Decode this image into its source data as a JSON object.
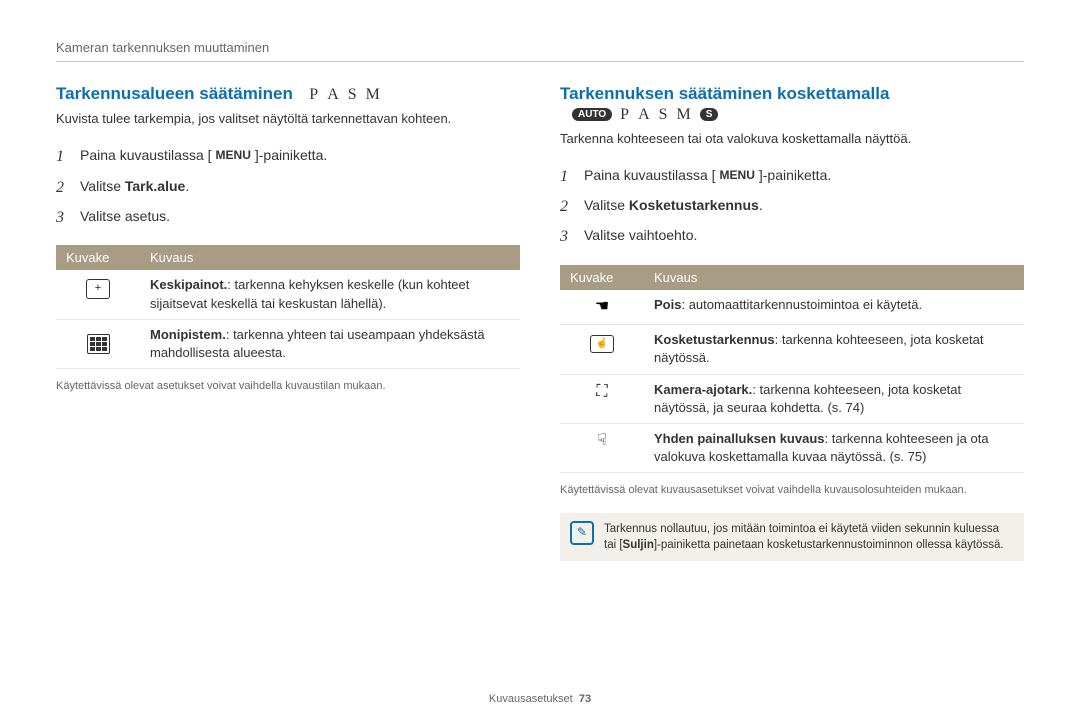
{
  "breadcrumb": "Kameran tarkennuksen muuttaminen",
  "left": {
    "title": "Tarkennusalueen säätäminen",
    "modes": [
      "P",
      "A",
      "S",
      "M"
    ],
    "intro": "Kuvista tulee tarkempia, jos valitset näytöltä tarkennettavan kohteen.",
    "steps": {
      "s1_pre": "Paina kuvaustilassa [",
      "s1_menu": "MENU",
      "s1_post": "]-painiketta.",
      "s2_pre": "Valitse ",
      "s2_bold": "Tark.alue",
      "s2_post": ".",
      "s3": "Valitse asetus."
    },
    "table": {
      "h1": "Kuvake",
      "h2": "Kuvaus",
      "rows": [
        {
          "desc_bold": "Keskipainot.",
          "desc": ": tarkenna kehyksen keskelle (kun kohteet sijaitsevat keskellä tai keskustan lähellä)."
        },
        {
          "desc_bold": "Monipistem.",
          "desc": ": tarkenna yhteen tai useampaan yhdeksästä mahdollisesta alueesta."
        }
      ]
    },
    "foot": "Käytettävissä olevat asetukset voivat vaihdella kuvaustilan mukaan."
  },
  "right": {
    "title": "Tarkennuksen säätäminen koskettamalla",
    "modes_pre": "AUTO",
    "modes": [
      "P",
      "A",
      "S",
      "M"
    ],
    "modes_post": "S",
    "intro": "Tarkenna kohteeseen tai ota valokuva koskettamalla näyttöä.",
    "steps": {
      "s1_pre": "Paina kuvaustilassa [",
      "s1_menu": "MENU",
      "s1_post": "]-painiketta.",
      "s2_pre": "Valitse ",
      "s2_bold": "Kosketustarkennus",
      "s2_post": ".",
      "s3": "Valitse vaihtoehto."
    },
    "table": {
      "h1": "Kuvake",
      "h2": "Kuvaus",
      "rows": [
        {
          "desc_bold": "Pois",
          "desc": ": automaattitarkennustoimintoa ei käytetä."
        },
        {
          "desc_bold": "Kosketustarkennus",
          "desc": ": tarkenna kohteeseen, jota kosketat näytössä."
        },
        {
          "desc_bold": "Kamera-ajotark.",
          "desc": ": tarkenna kohteeseen, jota kosketat näytössä, ja seuraa kohdetta. (s. 74)"
        },
        {
          "desc_bold": "Yhden painalluksen kuvaus",
          "desc": ": tarkenna kohteeseen ja ota valokuva koskettamalla kuvaa näytössä. (s. 75)"
        }
      ]
    },
    "foot": "Käytettävissä olevat kuvausasetukset voivat vaihdella kuvausolosuhteiden mukaan.",
    "note_pre": "Tarkennus nollautuu, jos mitään toimintoa ei käytetä viiden sekunnin kuluessa tai [",
    "note_bold": "Suljin",
    "note_post": "]-painiketta painetaan kosketustarkennustoiminnon ollessa käytössä."
  },
  "footer_label": "Kuvausasetukset",
  "footer_page": "73"
}
